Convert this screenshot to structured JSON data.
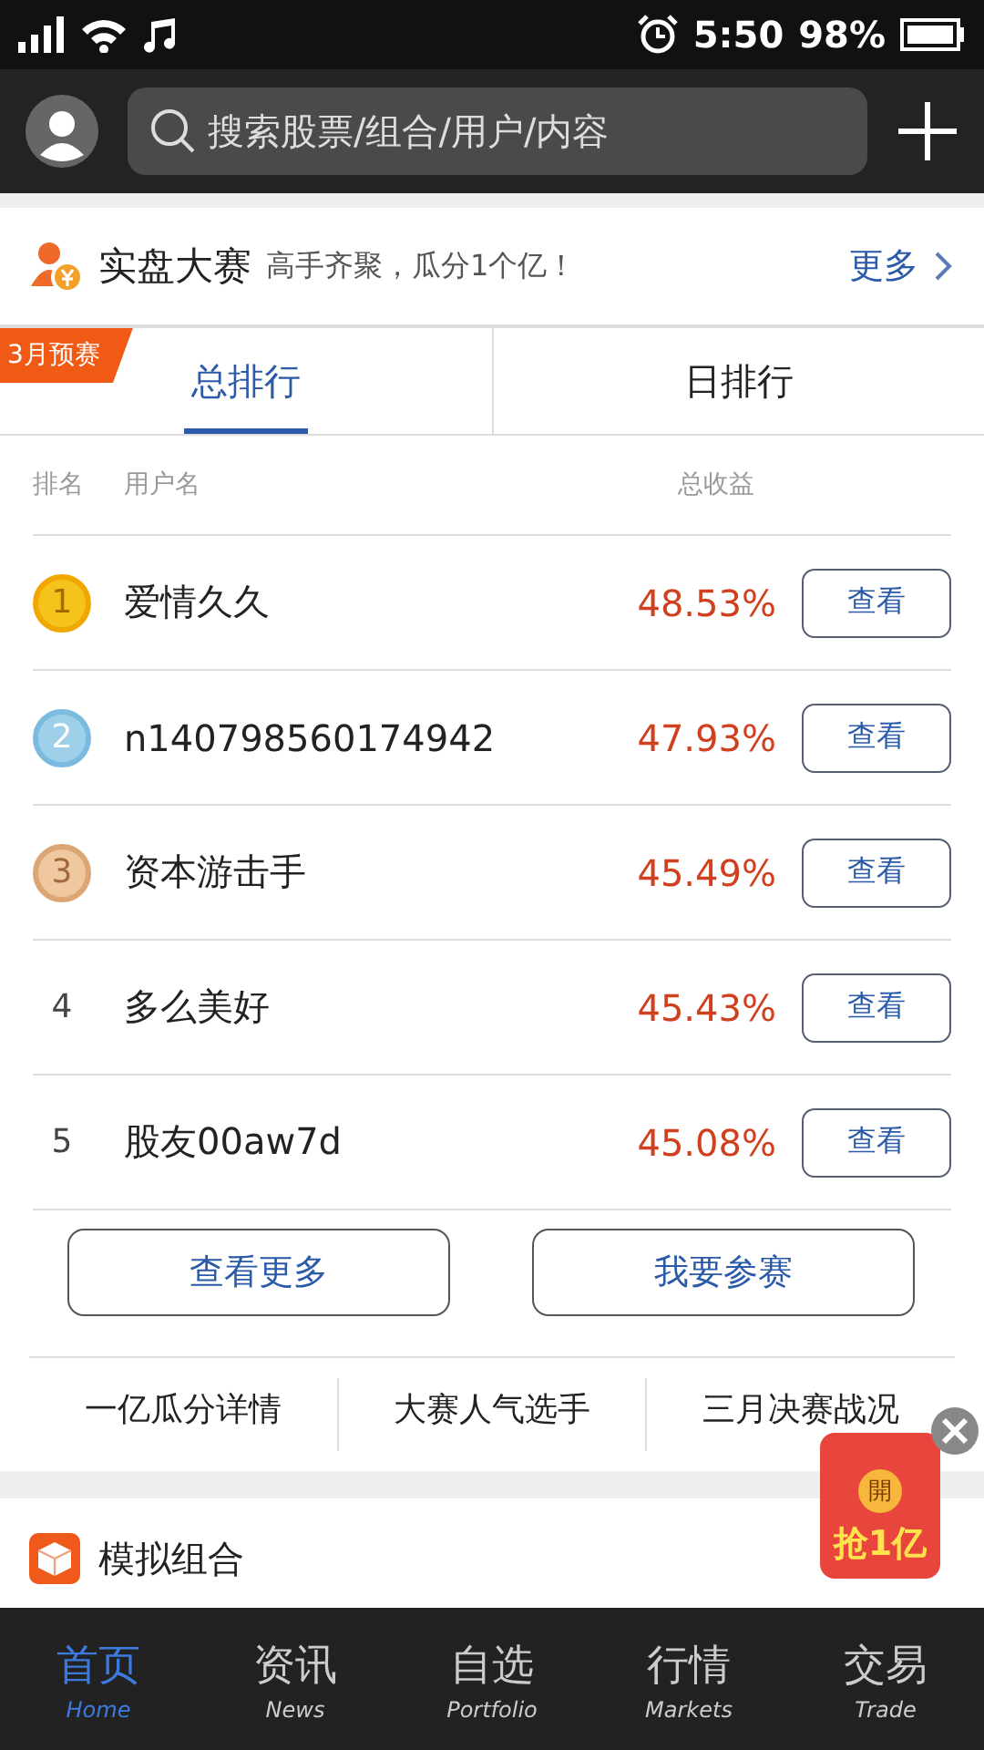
{
  "status_bar": {
    "time": "5:50",
    "battery": "98%"
  },
  "header": {
    "search": {
      "placeholder": "搜索股票/组合/用户/内容"
    }
  },
  "contest": {
    "title": "实盘大赛",
    "slogan": "高手齐聚，瓜分1个亿！",
    "more": "更多",
    "badge": "3月预赛",
    "tabs": [
      {
        "label": "总排行",
        "selected": true
      },
      {
        "label": "日排行",
        "selected": false
      }
    ],
    "columns": [
      "排名",
      "用户名",
      "总收益"
    ],
    "rows": [
      {
        "rank": "1",
        "kind": "gold",
        "name": "爱情久久",
        "return": "48.53%",
        "action": "查看"
      },
      {
        "rank": "2",
        "kind": "silver",
        "name": "n140798560174942",
        "return": "47.93%",
        "action": "查看"
      },
      {
        "rank": "3",
        "kind": "bronze",
        "name": "资本游击手",
        "return": "45.49%",
        "action": "查看"
      },
      {
        "rank": "4",
        "name": "多么美好",
        "return": "45.43%",
        "action": "查看"
      },
      {
        "rank": "5",
        "name": "股友00aw7d",
        "return": "45.08%",
        "action": "查看"
      }
    ],
    "buttons": [
      "查看更多",
      "我要参赛"
    ],
    "links": [
      "一亿瓜分详情",
      "大赛人气选手",
      "三月决赛战况"
    ]
  },
  "portfolio": {
    "title": "模拟组合"
  },
  "promo": {
    "seal": "開",
    "label": "抢1亿"
  },
  "nav": [
    {
      "label": "首页",
      "sublabel": "Home",
      "selected": true
    },
    {
      "label": "资讯",
      "sublabel": "News",
      "selected": false
    },
    {
      "label": "自选",
      "sublabel": "Portfolio",
      "selected": false
    },
    {
      "label": "行情",
      "sublabel": "Markets",
      "selected": false
    },
    {
      "label": "交易",
      "sublabel": "Trade",
      "selected": false
    }
  ]
}
